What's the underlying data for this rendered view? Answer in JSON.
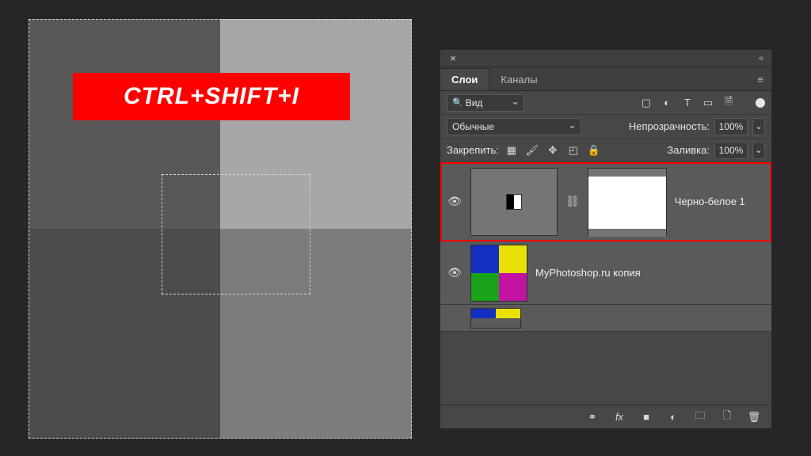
{
  "banner": {
    "text": "CTRL+SHIFT+I"
  },
  "panel": {
    "tabs": {
      "layers": "Слои",
      "channels": "Каналы"
    },
    "search": {
      "label": "Вид"
    },
    "blend": {
      "mode": "Обычные",
      "opacity_label": "Непрозрачность:",
      "opacity": "100%"
    },
    "lock": {
      "label": "Закрепить:",
      "fill_label": "Заливка:",
      "fill": "100%"
    }
  },
  "layers": [
    {
      "name": "Черно-белое 1",
      "selected": true,
      "type": "adjustment"
    },
    {
      "name": "MyPhotoshop.ru копия",
      "selected": false,
      "type": "bitmap"
    }
  ],
  "icons": {
    "close": "×",
    "collapse": "«",
    "image": "▢",
    "adjust": "◐",
    "text": "T",
    "shape": "▭",
    "smart": "🗎",
    "dot": "●",
    "link": "⚭",
    "fx": "fx",
    "mask": "■",
    "fill": "◐",
    "group": "🗀",
    "new": "🗋",
    "trash": "🗑",
    "eye": "👁",
    "lock_checker": "▦",
    "brush": "🖌",
    "move": "✥",
    "crop": "◰",
    "locked": "🔒"
  }
}
